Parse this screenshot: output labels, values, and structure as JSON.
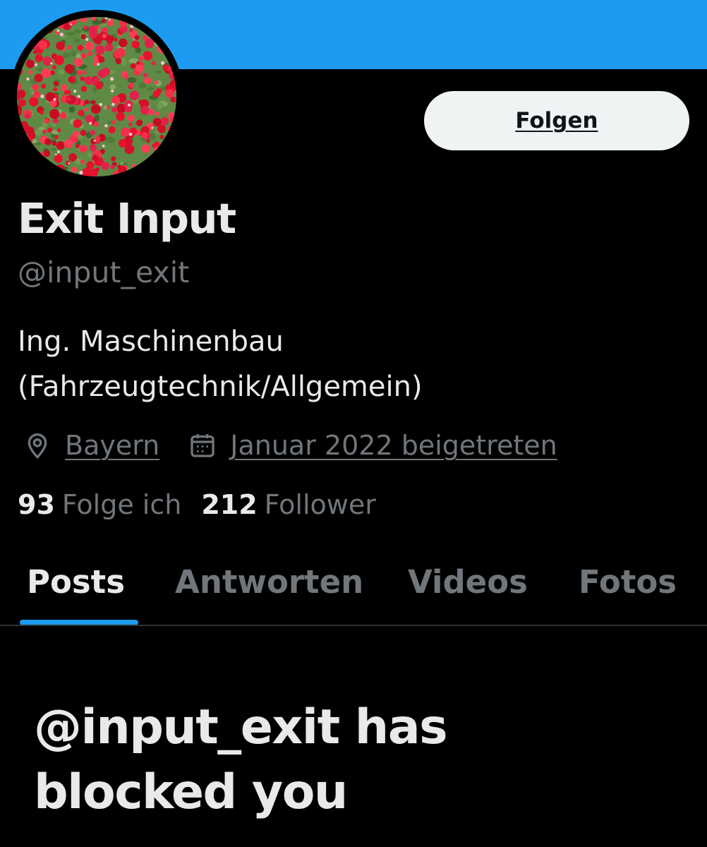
{
  "profile": {
    "display_name": "Exit Input",
    "handle": "@input_exit",
    "bio_line1": "Ing. Maschinenbau",
    "bio_line2": "(Fahrzeugtechnik/Allgemein)",
    "location": "Bayern",
    "joined": "Januar 2022 beigetreten",
    "following_count": "93",
    "following_label": "Folge ich",
    "followers_count": "212",
    "followers_label": "Follower",
    "avatar_icon": "red-flowers-avatar"
  },
  "actions": {
    "follow_label": "Folgen"
  },
  "tabs": [
    {
      "label": "Posts",
      "active": true
    },
    {
      "label": "Antworten",
      "active": false
    },
    {
      "label": "Videos",
      "active": false
    },
    {
      "label": "Fotos",
      "active": false
    }
  ],
  "blocked": {
    "message": "@input_exit has blocked you"
  },
  "icons": {
    "location": "location-pin-icon",
    "joined": "calendar-icon"
  },
  "colors": {
    "banner": "#1d9bf0",
    "background": "#000000",
    "primary_text": "#e7e9ea",
    "secondary_text": "#71767b",
    "accent": "#1d9bf0",
    "button_bg": "#eff3f4",
    "button_text": "#0f1419"
  }
}
